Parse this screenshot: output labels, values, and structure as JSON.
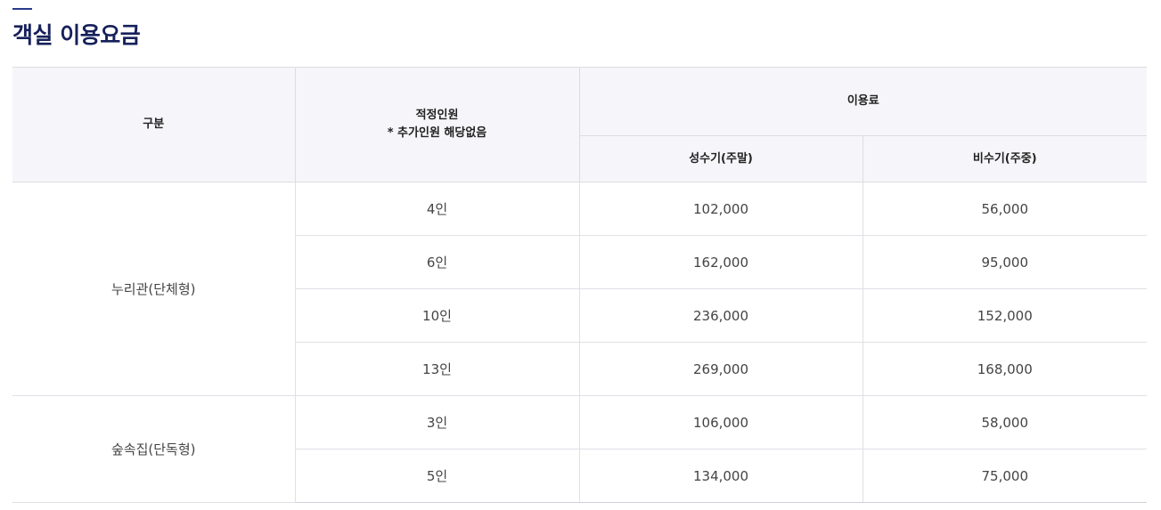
{
  "page": {
    "title": "객실 이용요금"
  },
  "table": {
    "headers": {
      "category": "구분",
      "capacity_line1": "적정인원",
      "capacity_line2": "* 추가인원 해당없음",
      "fee": "이용료",
      "peak": "성수기(주말)",
      "offpeak": "비수기(주중)"
    },
    "groups": [
      {
        "name": "누리관(단체형)",
        "rows": [
          {
            "capacity": "4인",
            "peak": "102,000",
            "offpeak": "56,000"
          },
          {
            "capacity": "6인",
            "peak": "162,000",
            "offpeak": "95,000"
          },
          {
            "capacity": "10인",
            "peak": "236,000",
            "offpeak": "152,000"
          },
          {
            "capacity": "13인",
            "peak": "269,000",
            "offpeak": "168,000"
          }
        ]
      },
      {
        "name": "숲속집(단독형)",
        "rows": [
          {
            "capacity": "3인",
            "peak": "106,000",
            "offpeak": "58,000"
          },
          {
            "capacity": "5인",
            "peak": "134,000",
            "offpeak": "75,000"
          }
        ]
      }
    ]
  },
  "colors": {
    "title": "#16205a",
    "header_bg": "#f6f6fa",
    "table_top_border": "#5f6374"
  }
}
